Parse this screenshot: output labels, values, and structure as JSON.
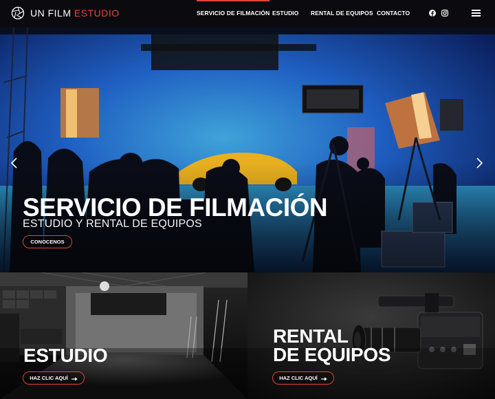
{
  "brand": {
    "name": "UN FILM",
    "accent": "ESTUDIO",
    "accent_color": "#e2453a"
  },
  "nav": {
    "items": [
      {
        "label": "SERVICIO DE FILMACIÓN",
        "active": true
      },
      {
        "label": "ESTUDIO",
        "active": false
      },
      {
        "label": "RENTAL DE EQUIPOS",
        "active": false
      },
      {
        "label": "CONTACTO",
        "active": false
      }
    ],
    "social": [
      "facebook-icon",
      "instagram-icon"
    ],
    "menu_icon": "hamburger-menu-icon"
  },
  "hero": {
    "title": "SERVICIO DE FILMACIÓN",
    "subtitle": "ESTUDIO Y RENTAL DE EQUIPOS",
    "cta": "CONOCENOS",
    "prev_icon": "chevron-left-icon",
    "next_icon": "chevron-right-icon"
  },
  "panels": {
    "studio": {
      "title": "ESTUDIO",
      "cta": "HAZ CLIC AQUÍ"
    },
    "rental": {
      "title_line1": "RENTAL",
      "title_line2": "DE EQUIPOS",
      "cta": "HAZ CLIC AQUÍ"
    }
  }
}
